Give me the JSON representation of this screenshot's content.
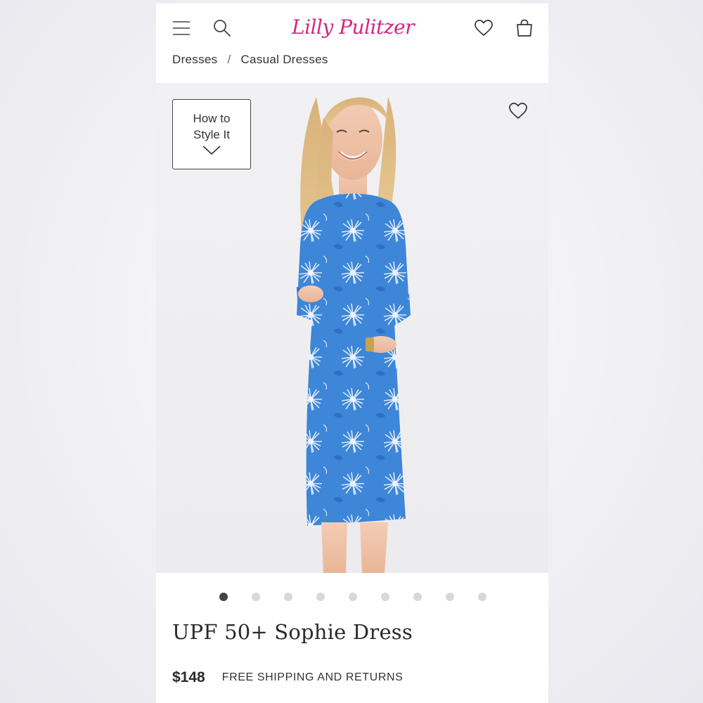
{
  "header": {
    "menu_icon": "hamburger-menu-icon",
    "search_icon": "search-icon",
    "logo_text": "Lilly Pulitzer",
    "logo_color": "#d6257f",
    "wishlist_icon": "heart-icon",
    "bag_icon": "shopping-bag-icon"
  },
  "breadcrumb": {
    "items": [
      "Dresses",
      "Casual Dresses"
    ],
    "separator": "/"
  },
  "hero": {
    "style_button_label": "How to Style It",
    "style_button_icon": "chevron-down-icon",
    "favorite_icon": "heart-icon",
    "image_description_colors": {
      "dress": "#3d86d8",
      "pattern": "#e8eef8",
      "background": "#ececef"
    }
  },
  "carousel": {
    "total_images": 9,
    "active_index": 0
  },
  "product": {
    "title": "UPF 50+ Sophie Dress",
    "price": "$148",
    "shipping_note": "FREE SHIPPING AND RETURNS"
  }
}
